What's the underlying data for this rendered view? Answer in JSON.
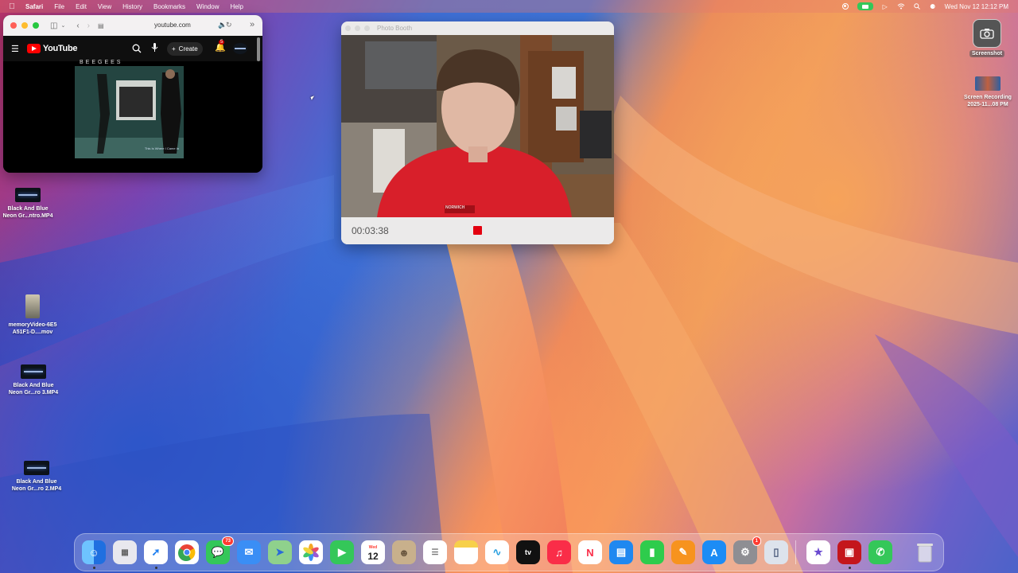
{
  "menubar": {
    "app_name": "Safari",
    "items": [
      "File",
      "Edit",
      "View",
      "History",
      "Bookmarks",
      "Window",
      "Help"
    ],
    "datetime": "Wed Nov 12  12:12 PM"
  },
  "safari": {
    "url": "youtube.com",
    "youtube": {
      "logo_text": "YouTube",
      "create_label": "Create",
      "notification_count": "5",
      "album_artist": "BEEGEES",
      "album_subtitle": "This Is Where I Came In"
    }
  },
  "photo_booth": {
    "title": "Photo Booth",
    "timer": "00:03:38",
    "shirt_text": "NORWICH"
  },
  "desktop": {
    "screenshot_label": "Screenshot",
    "screen_recording_label": "Screen Recording 2025-11...08 PM",
    "icons": [
      {
        "line1": "Black And Blue",
        "line2": "Neon Gr...ntro.MP4"
      },
      {
        "line1": "memoryVideo-6E5",
        "line2": "A51F1-D....mov"
      },
      {
        "line1": "Black And Blue",
        "line2": "Neon Gr...ro 3.MP4"
      },
      {
        "line1": "Black And Blue",
        "line2": "Neon Gr...ro 2.MP4"
      }
    ]
  },
  "dock": {
    "calendar_month": "Wed",
    "calendar_day": "12",
    "messages_badge": "73",
    "settings_badge": "1",
    "tv_label": "tv",
    "apps": [
      "Finder",
      "Launchpad",
      "Safari",
      "Chrome",
      "Messages",
      "Mail",
      "Maps",
      "Photos",
      "FaceTime",
      "Calendar",
      "Contacts",
      "Reminders",
      "Notes",
      "Freeform",
      "TV",
      "Music",
      "News",
      "Keynote",
      "Numbers",
      "Pages",
      "App Store",
      "System Settings",
      "iPhone Mirroring",
      "iMovie",
      "Photo Booth",
      "Phone",
      "Trash"
    ]
  },
  "colors": {
    "record_red": "#e3000f",
    "youtube_red": "#ff0000",
    "facetime_green": "#34c759"
  }
}
